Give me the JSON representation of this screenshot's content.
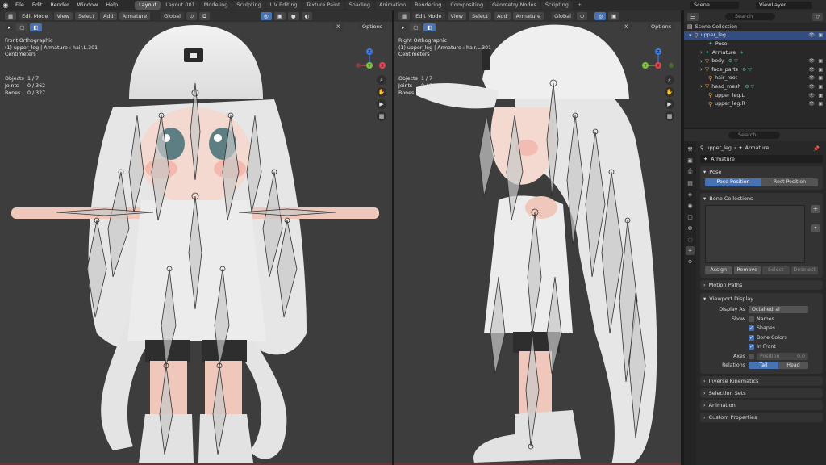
{
  "menu": [
    "File",
    "Edit",
    "Render",
    "Window",
    "Help"
  ],
  "workspaces": [
    "Layout",
    "Layout.001",
    "Modeling",
    "Sculpting",
    "UV Editing",
    "Texture Paint",
    "Shading",
    "Animation",
    "Rendering",
    "Compositing",
    "Geometry Nodes",
    "Scripting"
  ],
  "active_workspace": "Layout",
  "scene": "Scene",
  "view_layer": "ViewLayer",
  "viewport_header": {
    "mode": "Edit Mode",
    "view": "View",
    "select": "Select",
    "add": "Add",
    "armature": "Armature",
    "orientation": "Global",
    "options": "Options",
    "x": "X"
  },
  "left_viewport": {
    "title": "Front Orthographic",
    "context": "(1) upper_leg | Armature : hair.L.301",
    "units": "Centimeters",
    "stats": [
      {
        "k": "Objects",
        "v": "1 / 7"
      },
      {
        "k": "Joints",
        "v": "0 / 362"
      },
      {
        "k": "Bones",
        "v": "0 / 327"
      }
    ]
  },
  "right_viewport": {
    "title": "Right Orthographic",
    "context": "(1) upper_leg | Armature : hair.L.301",
    "units": "Centimeters",
    "stats": [
      {
        "k": "Objects",
        "v": "1 / 7"
      },
      {
        "k": "Joints",
        "v": "0 / 362"
      },
      {
        "k": "Bones",
        "v": "0 / 327"
      }
    ]
  },
  "gizmo": {
    "x": "X",
    "y": "Y",
    "z": "Z"
  },
  "outliner": {
    "search_placeholder": "Search",
    "root": "Scene Collection",
    "items": [
      {
        "label": "upper_leg",
        "icon": "armature-object-icon",
        "selected": true
      },
      {
        "label": "Pose",
        "icon": "pose-icon"
      },
      {
        "label": "Armature",
        "icon": "armature-data-icon"
      },
      {
        "label": "body",
        "icon": "mesh-icon"
      },
      {
        "label": "face_parts",
        "icon": "mesh-icon"
      },
      {
        "label": "hair_root",
        "icon": "bone-icon"
      },
      {
        "label": "head_mesh",
        "icon": "mesh-icon"
      },
      {
        "label": "upper_leg.L",
        "icon": "bone-icon"
      },
      {
        "label": "upper_leg.R",
        "icon": "bone-icon"
      }
    ]
  },
  "properties": {
    "search_placeholder": "Search",
    "crumb_object": "upper_leg",
    "crumb_data": "Armature",
    "data_name": "Armature",
    "pose_panel": "Pose",
    "pose_position": "Pose Position",
    "rest_position": "Rest Position",
    "bone_collections": "Bone Collections",
    "assign": "Assign",
    "remove": "Remove",
    "select": "Select",
    "deselect": "Deselect",
    "motion_paths": "Motion Paths",
    "viewport_display": "Viewport Display",
    "display_as_label": "Display As",
    "display_as": "Octahedral",
    "show_label": "Show",
    "names": "Names",
    "shapes": "Shapes",
    "bone_colors": "Bone Colors",
    "in_front": "In Front",
    "axes_label": "Axes",
    "position": "Position",
    "position_value": "0.0",
    "relations_label": "Relations",
    "tail": "Tail",
    "head": "Head",
    "inverse_kinematics": "Inverse Kinematics",
    "selection_sets": "Selection Sets",
    "animation": "Animation",
    "custom_properties": "Custom Properties"
  },
  "colors": {
    "viewport_bg": "#3d3d3d",
    "accent": "#4772b3",
    "panel": "#282828",
    "x_axis": "#e8424d",
    "y_axis": "#7ec33b",
    "z_axis": "#3f7be2"
  }
}
